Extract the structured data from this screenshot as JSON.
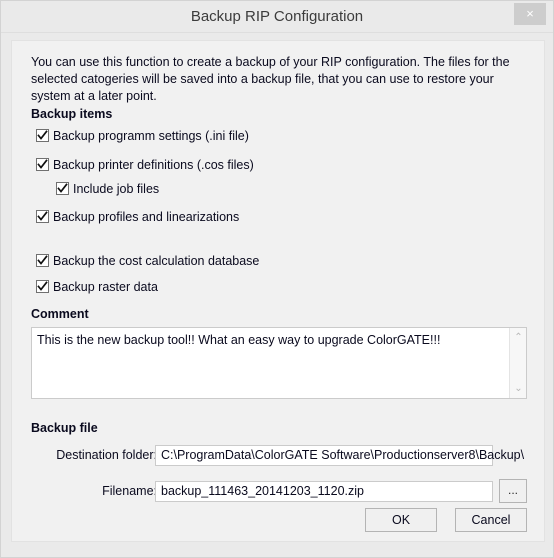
{
  "window": {
    "title": "Backup RIP Configuration",
    "close_label": "×"
  },
  "intro": {
    "text": "You can use this function to create a backup of your RIP configuration. The files for the selected catogeries will be saved into a backup file, that you can use to restore your system at a later point."
  },
  "sections": {
    "backup_items": "Backup items",
    "comment": "Comment",
    "backup_file": "Backup file"
  },
  "checkboxes": [
    {
      "label": "Backup programm settings (.ini file)",
      "checked": true,
      "indent": false
    },
    {
      "label": "Backup printer definitions (.cos files)",
      "checked": true,
      "indent": false
    },
    {
      "label": "Include job files",
      "checked": true,
      "indent": true
    },
    {
      "label": "Backup profiles and linearizations",
      "checked": true,
      "indent": false
    },
    {
      "label": "Backup the cost calculation database",
      "checked": true,
      "indent": false
    },
    {
      "label": "Backup raster data",
      "checked": true,
      "indent": false
    }
  ],
  "comment": {
    "value": "This is the new backup tool!! What an easy way to upgrade ColorGATE!!!",
    "placeholder": "",
    "scroll_up_glyph": "⌃",
    "scroll_down_glyph": "⌄"
  },
  "backup_file": {
    "destination_label": "Destination folder:",
    "destination_value": "C:\\ProgramData\\ColorGATE Software\\Productionserver8\\Backup\\",
    "destination_placeholder": "",
    "filename_label": "Filename:",
    "filename_value": "backup_111463_20141203_1120.zip",
    "filename_placeholder": "",
    "browse_label": "..."
  },
  "buttons": {
    "ok": "OK",
    "cancel": "Cancel"
  },
  "colors": {
    "window_background": "#eaeaea",
    "panel_background": "#f1f1f1",
    "field_background": "#ffffff",
    "close_button": "#cdcdcd",
    "text": "#0a0a1e"
  }
}
